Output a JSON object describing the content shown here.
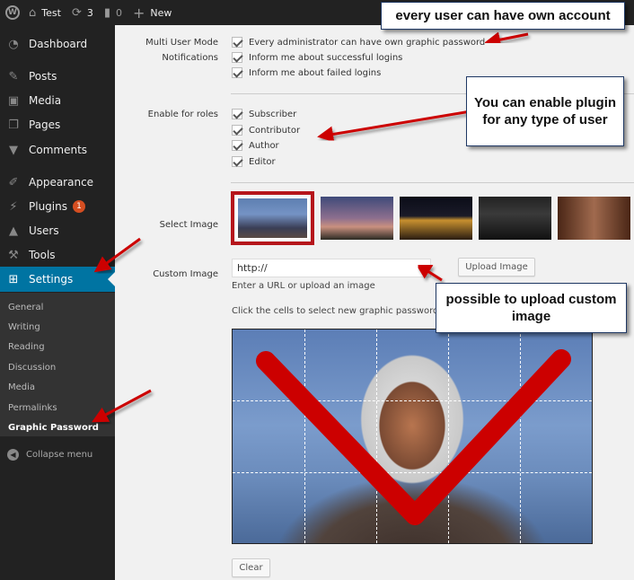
{
  "adminbar": {
    "site_name": "Test",
    "updates_count": "3",
    "comments_count": "0",
    "new_label": "New"
  },
  "sidebar": {
    "items": [
      {
        "label": "Dashboard",
        "icon": "dashboard-icon"
      },
      {
        "label": "Posts",
        "icon": "pin-icon"
      },
      {
        "label": "Media",
        "icon": "media-icon"
      },
      {
        "label": "Pages",
        "icon": "pages-icon"
      },
      {
        "label": "Comments",
        "icon": "comment-icon"
      },
      {
        "label": "Appearance",
        "icon": "brush-icon"
      },
      {
        "label": "Plugins",
        "icon": "plug-icon",
        "badge": "1"
      },
      {
        "label": "Users",
        "icon": "user-icon"
      },
      {
        "label": "Tools",
        "icon": "wrench-icon"
      },
      {
        "label": "Settings",
        "icon": "settings-icon",
        "active": true
      }
    ],
    "submenu": [
      "General",
      "Writing",
      "Reading",
      "Discussion",
      "Media",
      "Permalinks",
      "Graphic Password"
    ],
    "current_submenu": "Graphic Password",
    "collapse_label": "Collapse menu"
  },
  "settings": {
    "multi_user_label": "Multi User Mode",
    "notifications_label": "Notifications",
    "options": [
      {
        "label": "Every administrator can have own graphic password",
        "checked": true
      },
      {
        "label": "Inform me about successful logins",
        "checked": true
      },
      {
        "label": "Inform me about failed logins",
        "checked": true
      }
    ],
    "roles_label": "Enable for roles",
    "roles": [
      {
        "label": "Subscriber",
        "checked": true
      },
      {
        "label": "Contributor",
        "checked": true
      },
      {
        "label": "Author",
        "checked": true
      },
      {
        "label": "Editor",
        "checked": true
      }
    ],
    "select_image_label": "Select Image",
    "images": [
      "fighter-pilot",
      "cheetah-sunset",
      "bridge-night",
      "men-in-black",
      "woman-portrait"
    ],
    "selected_image": "fighter-pilot",
    "custom_image_label": "Custom Image",
    "custom_image_value": "http://",
    "upload_button": "Upload Image",
    "custom_image_hint": "Enter a URL or upload an image",
    "grid_hint": "Click the cells to select new graphic password",
    "grid": {
      "columns": 5,
      "rows": 3
    },
    "clear_button": "Clear"
  },
  "annotations": {
    "account": "every user can have own account",
    "roles": "You can enable plugin for any type of user",
    "upload": "possible to upload custom image",
    "color": "#cc0000"
  }
}
